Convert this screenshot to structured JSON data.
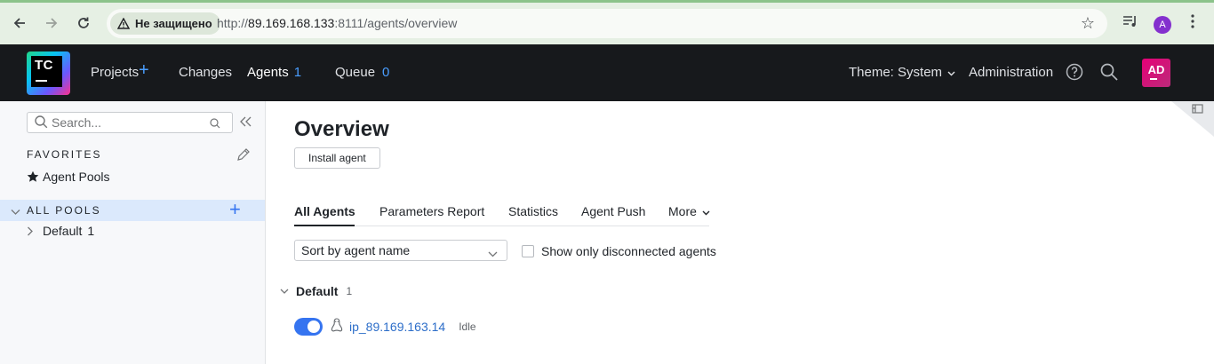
{
  "browser": {
    "security_label": "Не защищено",
    "url_scheme": "http://",
    "url_host": "89.169.168.133",
    "url_rest": ":8111/agents/overview",
    "profile_initial": "A"
  },
  "header": {
    "logo_text": "TC",
    "nav": {
      "projects": "Projects",
      "changes": "Changes",
      "agents": "Agents",
      "agents_count": "1",
      "queue": "Queue",
      "queue_count": "0"
    },
    "theme": "Theme: System",
    "administration": "Administration",
    "avatar_initials": "AD"
  },
  "sidebar": {
    "search_placeholder": "Search...",
    "favorites_title": "FAVORITES",
    "favorites": [
      {
        "label": "Agent Pools"
      }
    ],
    "pools_title": "ALL POOLS",
    "pools": [
      {
        "label": "Default",
        "count": "1"
      }
    ]
  },
  "main": {
    "title": "Overview",
    "install_button": "Install agent",
    "tabs": [
      {
        "label": "All Agents"
      },
      {
        "label": "Parameters Report"
      },
      {
        "label": "Statistics"
      },
      {
        "label": "Agent Push"
      },
      {
        "label": "More"
      }
    ],
    "sort_value": "Sort by agent name",
    "disconnected_label": "Show only disconnected agents",
    "groups": [
      {
        "name": "Default",
        "count": "1",
        "agents": [
          {
            "name": "ip_89.169.163.14",
            "status": "Idle",
            "enabled": true
          }
        ]
      }
    ]
  },
  "colors": {
    "header_bg": "#17191c",
    "accent": "#3574f0",
    "link": "#2d6ec9",
    "selected_row": "#dbe9fc",
    "avatar": "#e60077"
  }
}
